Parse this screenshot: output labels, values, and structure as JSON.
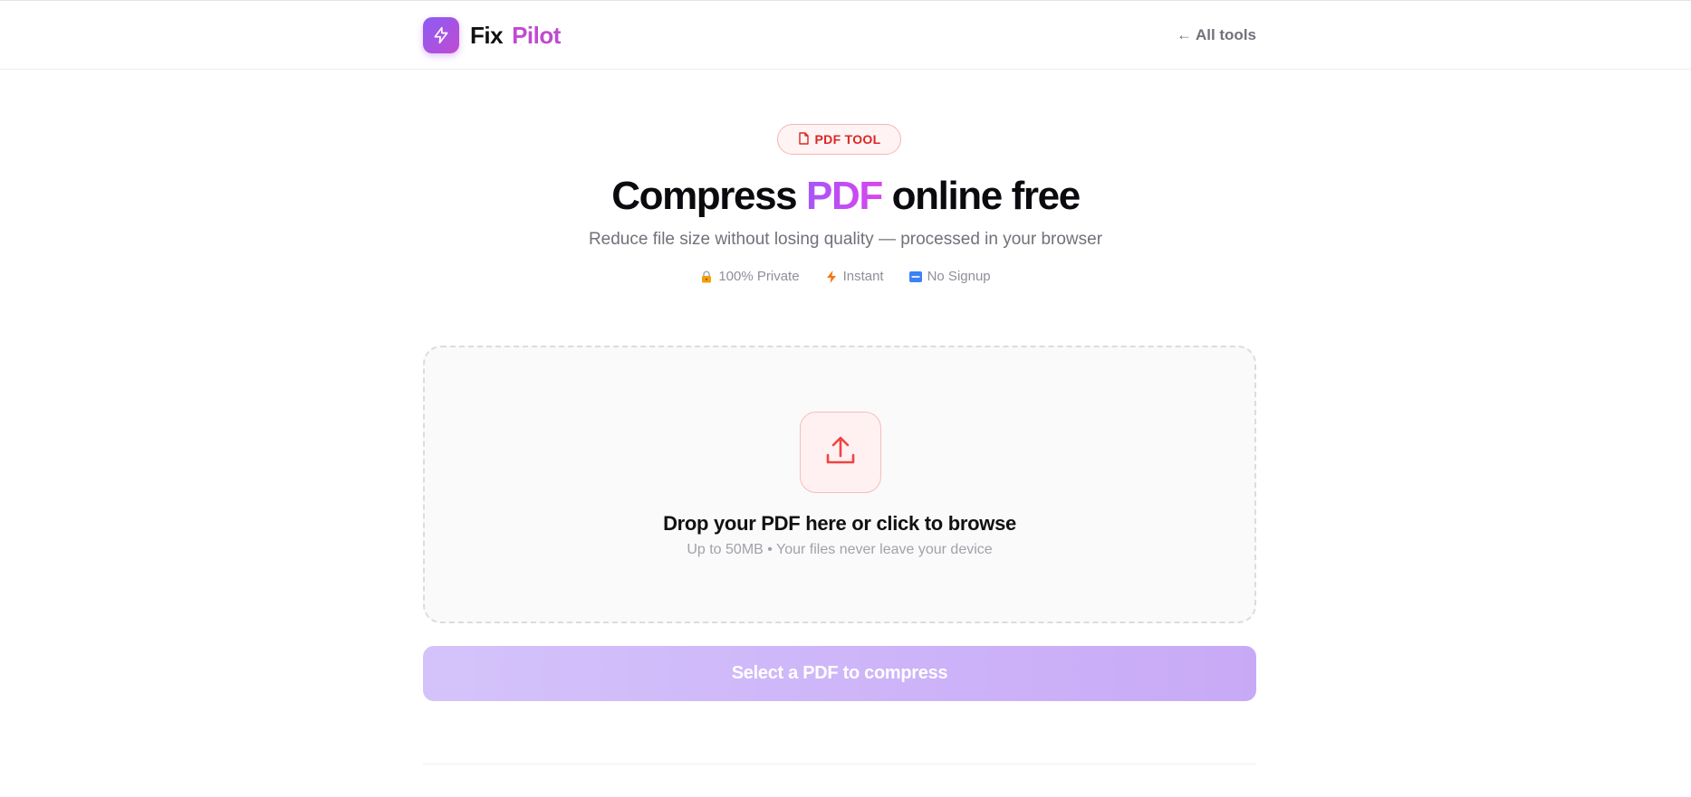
{
  "header": {
    "brand_part1": "Fix",
    "brand_part2": "Pilot",
    "all_tools_label": "All tools",
    "back_arrow": "←"
  },
  "hero": {
    "badge_label": "PDF TOOL",
    "title_before": "Compress ",
    "title_accent": "PDF",
    "title_after": " online free",
    "subtitle": "Reduce file size without losing quality — processed in your browser"
  },
  "features": [
    {
      "icon": "lock-icon",
      "label": "100% Private"
    },
    {
      "icon": "lightning-icon",
      "label": "Instant"
    },
    {
      "icon": "free-icon",
      "label": "No Signup"
    }
  ],
  "dropzone": {
    "icon": "upload-icon",
    "title": "Drop your PDF here or click to browse",
    "hint": "Up to 50MB • Your files never leave your device"
  },
  "cta": {
    "label": "Select a PDF to compress"
  },
  "colors": {
    "brand_gradient_start": "#8b5cf6",
    "brand_gradient_end": "#c04bd0",
    "accent_red": "#dc2626",
    "cta_gradient_start": "#d4c3fb",
    "cta_gradient_end": "#c8a9f6"
  }
}
